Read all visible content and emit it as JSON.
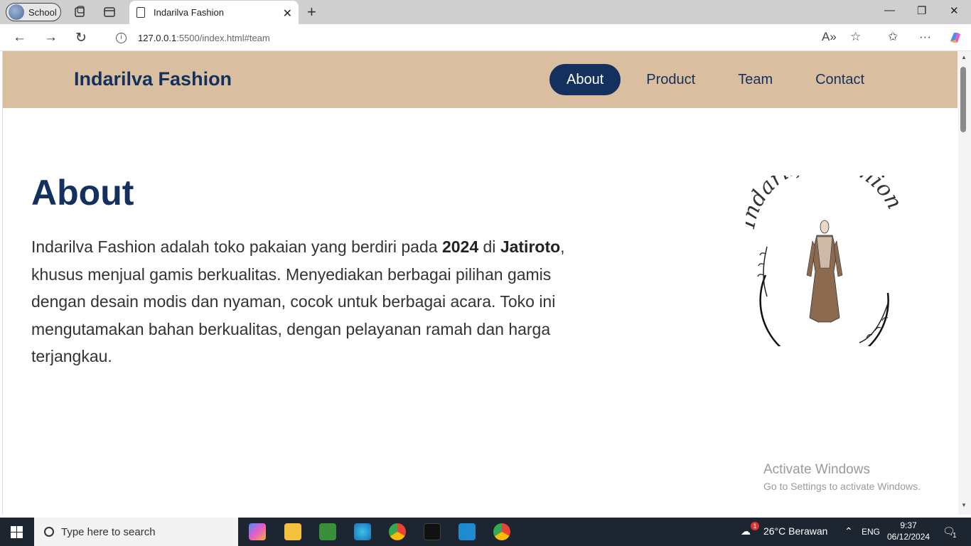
{
  "browser": {
    "profile_label": "School",
    "tab_title": "Indarilva Fashion",
    "url_host": "127.0.0.1",
    "url_rest": ":5500/index.html#team"
  },
  "site": {
    "brand": "Indarilva Fashion",
    "nav": [
      "About",
      "Product",
      "Team",
      "Contact"
    ],
    "active_nav": "About"
  },
  "about": {
    "title": "About",
    "p_part1": "Indarilva Fashion adalah toko pakaian yang berdiri pada ",
    "p_year": "2024",
    "p_part2": " di ",
    "p_place": "Jatiroto",
    "p_part3": ", khusus menjual gamis berkualitas. Menyediakan berbagai pilihan gamis dengan desain modis dan nyaman, cocok untuk berbagai acara. Toko ini mengutamakan bahan berkualitas, dengan pelayanan ramah dan harga terjangkau.",
    "logo_text": "Indarilfa Fashion"
  },
  "watermark": {
    "line1": "Activate Windows",
    "line2": "Go to Settings to activate Windows."
  },
  "taskbar": {
    "search_placeholder": "Type here to search",
    "weather": "26°C  Berawan",
    "lang": "ENG",
    "time": "9:37",
    "date": "06/12/2024",
    "notif_count": "1",
    "weather_badge": "1"
  },
  "colors": {
    "header_bg": "#d9bfa0",
    "brand_navy": "#14305e"
  }
}
